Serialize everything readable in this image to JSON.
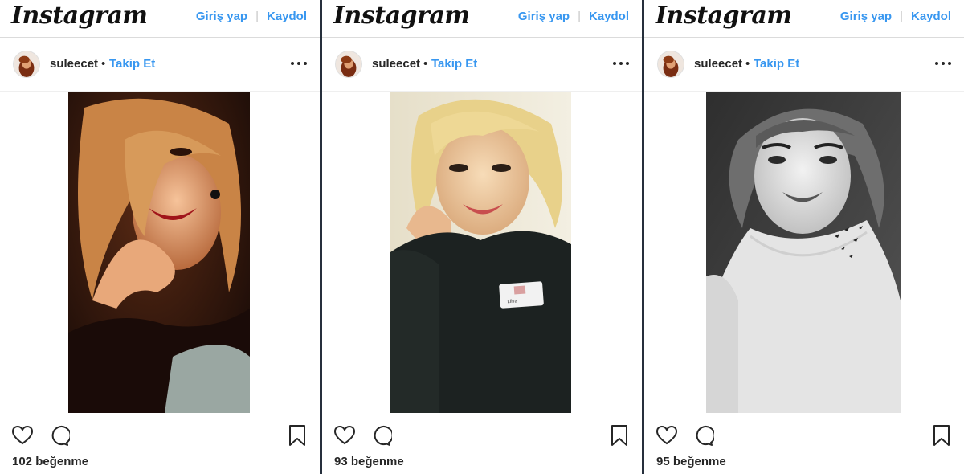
{
  "header": {
    "logo": "Instagram",
    "login_label": "Giriş yap",
    "separator": "|",
    "signup_label": "Kaydol"
  },
  "colors": {
    "link": "#3897f0",
    "text": "#262626",
    "divider": "#262f3c"
  },
  "posts": [
    {
      "username": "suleecet",
      "dot": "•",
      "follow_label": "Takip Et",
      "likes_text": "102 beğenme",
      "icons": [
        "heart-icon",
        "comment-icon",
        "bookmark-icon",
        "more-options-icon"
      ],
      "photo": "warm-tone portrait of smiling woman"
    },
    {
      "username": "suleecet",
      "dot": "•",
      "follow_label": "Takip Et",
      "likes_text": "93 beğenme",
      "icons": [
        "heart-icon",
        "comment-icon",
        "bookmark-icon",
        "more-options-icon"
      ],
      "photo": "blonde woman in dark sweater",
      "badge_text": "Lilva"
    },
    {
      "username": "suleecet",
      "dot": "•",
      "follow_label": "Takip Et",
      "likes_text": "95 beğenme",
      "icons": [
        "heart-icon",
        "comment-icon",
        "bookmark-icon",
        "more-options-icon"
      ],
      "photo": "black and white portrait with bird tattoo"
    }
  ]
}
